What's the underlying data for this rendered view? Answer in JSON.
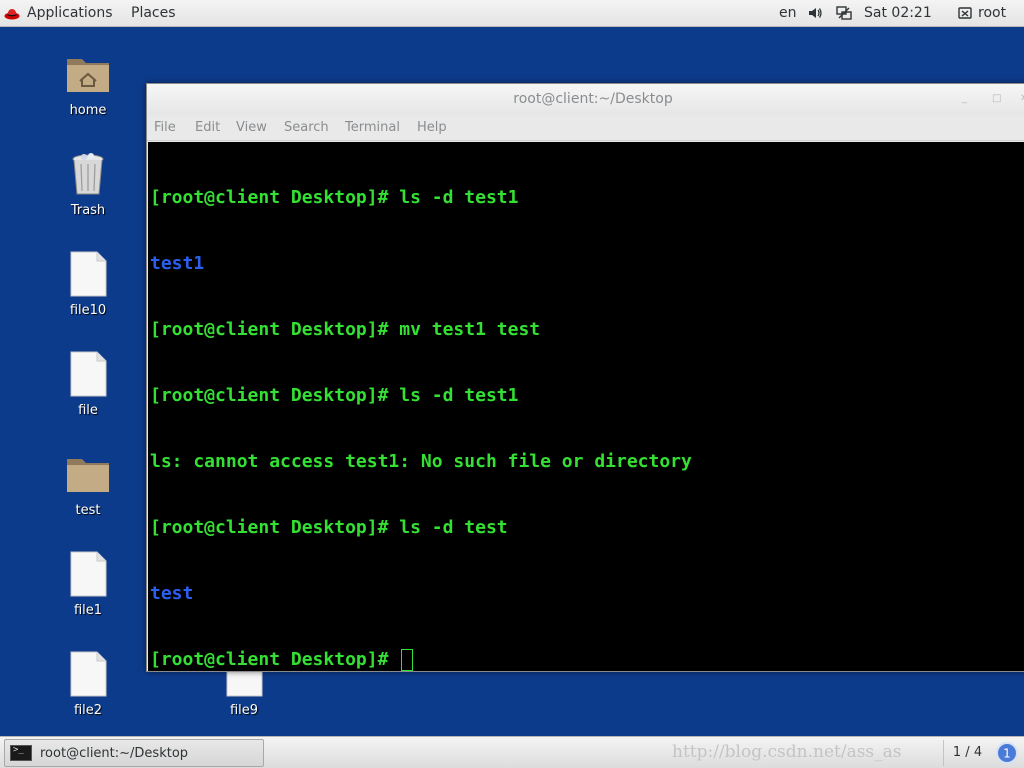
{
  "topbar": {
    "applications_label": "Applications",
    "places_label": "Places",
    "language": "en",
    "clock": "Sat 02:21",
    "user": "root",
    "icons": [
      "redhat-icon",
      "volume-icon",
      "network-icon",
      "user-icon"
    ]
  },
  "desktop": {
    "icons": [
      {
        "label": "home",
        "icon": "home-folder-icon"
      },
      {
        "label": "Trash",
        "icon": "trash-icon"
      },
      {
        "label": "file10",
        "icon": "file-icon"
      },
      {
        "label": "file",
        "icon": "file-icon"
      },
      {
        "label": "test",
        "icon": "folder-icon"
      },
      {
        "label": "file1",
        "icon": "file-icon"
      },
      {
        "label": "file2",
        "icon": "file-icon"
      },
      {
        "label": "file9",
        "icon": "file-icon"
      }
    ]
  },
  "window": {
    "title": "root@client:~/Desktop",
    "menu": [
      "File",
      "Edit",
      "View",
      "Search",
      "Terminal",
      "Help"
    ],
    "terminal_lines": [
      {
        "text": "[root@client Desktop]# ls -d test1",
        "color": "green"
      },
      {
        "text": "test1",
        "color": "blue"
      },
      {
        "text": "[root@client Desktop]# mv test1 test",
        "color": "green"
      },
      {
        "text": "[root@client Desktop]# ls -d test1",
        "color": "green"
      },
      {
        "text": "ls: cannot access test1: No such file or directory",
        "color": "green"
      },
      {
        "text": "[root@client Desktop]# ls -d test",
        "color": "green"
      },
      {
        "text": "test",
        "color": "blue"
      },
      {
        "text": "[root@client Desktop]# ",
        "color": "green"
      }
    ],
    "colors": {
      "prompt": "#33e033",
      "directory": "#2b5ff0",
      "background": "#000000"
    }
  },
  "taskbar": {
    "task_label": "root@client:~/Desktop",
    "watermark": "http://blog.csdn.net/ass_as",
    "pager": "1 / 4",
    "notification_count": "1"
  }
}
